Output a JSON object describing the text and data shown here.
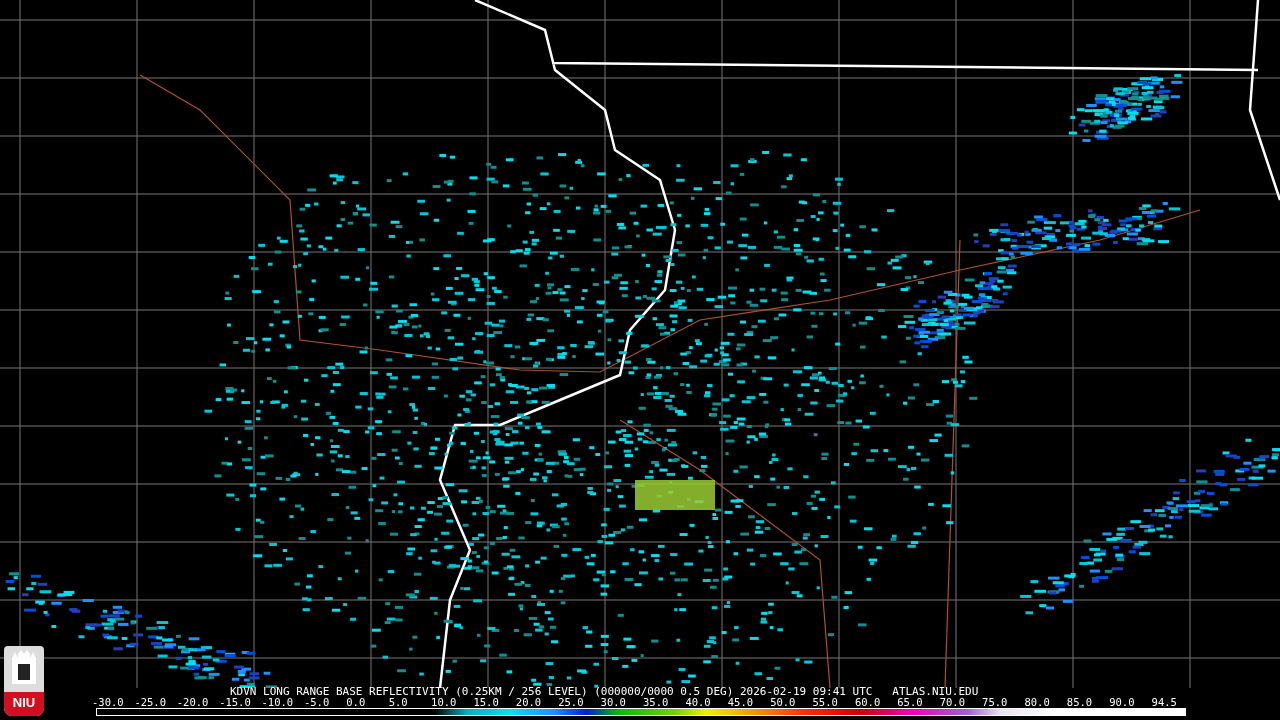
{
  "logo": {
    "text": "NIU"
  },
  "product_title": "KDVN LONG RANGE BASE REFLECTIVITY (0.25KM / 256 LEVEL) (000000/0000 0.5 DEG) 2026-02-19 09:41 UTC   ATLAS.NIU.EDU",
  "legend": {
    "labels": [
      "-30.0",
      "-25.0",
      "-20.0",
      "-15.0",
      "-10.0",
      "-5.0",
      "0.0",
      "5.0",
      "10.0",
      "15.0",
      "20.0",
      "25.0",
      "30.0",
      "35.0",
      "40.0",
      "45.0",
      "50.0",
      "55.0",
      "60.0",
      "65.0",
      "70.0",
      "75.0",
      "80.0",
      "85.0",
      "90.0",
      "94.5"
    ]
  }
}
